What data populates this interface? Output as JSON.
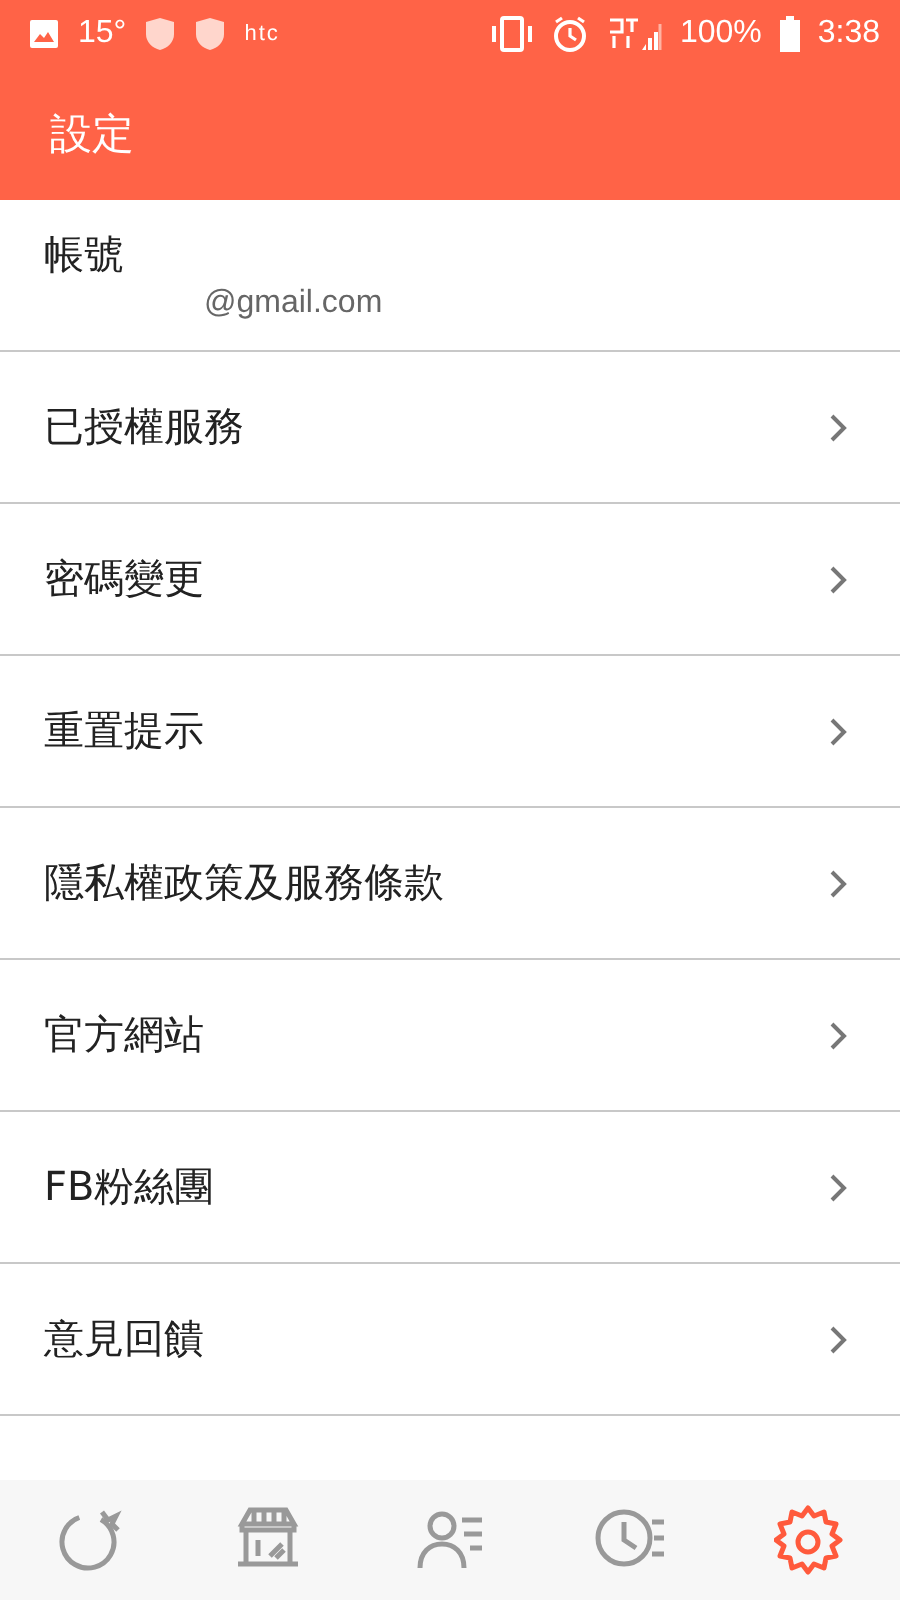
{
  "status_bar": {
    "temperature": "15°",
    "carrier": "htc",
    "battery": "100%",
    "time": "3:38"
  },
  "header": {
    "title": "設定"
  },
  "account": {
    "label": "帳號",
    "email": "@gmail.com"
  },
  "items": [
    {
      "label": "已授權服務"
    },
    {
      "label": "密碼變更"
    },
    {
      "label": "重置提示"
    },
    {
      "label": "隱私權政策及服務條款"
    },
    {
      "label": "官方網站"
    },
    {
      "label": "FB粉絲團"
    },
    {
      "label": "意見回饋"
    }
  ],
  "tabs": [
    {
      "kind": "tomato",
      "selected": false
    },
    {
      "kind": "store",
      "selected": false
    },
    {
      "kind": "contacts",
      "selected": false
    },
    {
      "kind": "history",
      "selected": false
    },
    {
      "kind": "settings",
      "selected": true
    }
  ]
}
